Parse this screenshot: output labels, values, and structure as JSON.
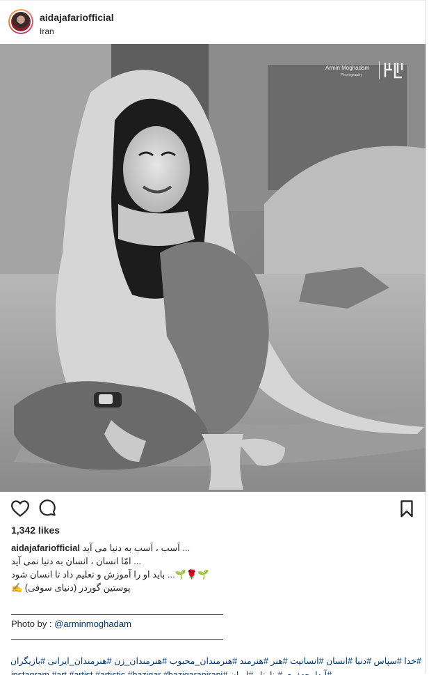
{
  "header": {
    "username": "aidajafariofficial",
    "location": "Iran"
  },
  "photo": {
    "watermark_name": "Armin Moghadam",
    "watermark_sub": "Photography"
  },
  "actions": {
    "like_icon": "heart-outline-icon",
    "comment_icon": "comment-bubble-icon",
    "save_icon": "bookmark-icon"
  },
  "likes": "1,342 likes",
  "caption": {
    "username": "aidajafariofficial",
    "lines": [
      "... اَسب ، اَسب به دنیا می آید",
      "... امّا انسان ، انسان به دنیا نمی آید",
      "🌱🌹🌱... باید او را آموزش و تعلیم داد تا انسان شود",
      "پوستین گوردر (دنیای سوفی) ✍"
    ],
    "photo_by_label": "Photo by : ",
    "photo_by_mention": "@arminmoghadam",
    "hashtags_line1": "#خدا #سپاس #دنیا #انسان #انسانیت #هنر #هنرمند #هنرمندان_محبوب #هنرمندان_زن #هنرمندان_ایرانی #بازیگران #بازیگر",
    "hashtags_line2": "#آیدا_جعفری #بنا_تار #ایران #instagram #art #artist #artistic #bazigar #bazigaranirani"
  },
  "colors": {
    "text": "#262626",
    "link": "#003569",
    "border": "#dbdbdb"
  }
}
